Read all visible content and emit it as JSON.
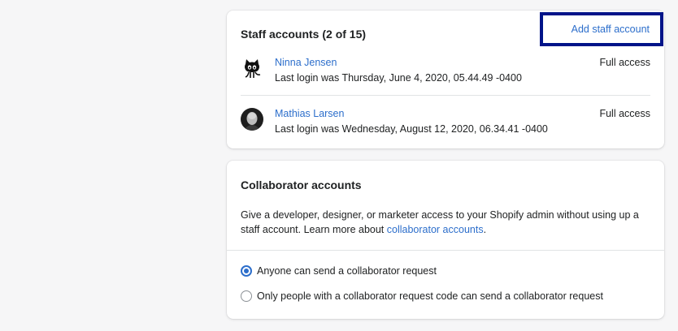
{
  "staff": {
    "title": "Staff accounts (2 of 15)",
    "add_label": "Add staff account",
    "members": [
      {
        "name": "Ninna Jensen",
        "last_login": "Last login was Thursday, June 4, 2020, 05.44.49 -0400",
        "access": "Full access",
        "avatar": "octocat-avatar-icon"
      },
      {
        "name": "Mathias Larsen",
        "last_login": "Last login was Wednesday, August 12, 2020, 06.34.41 -0400",
        "access": "Full access",
        "avatar": "person-photo-avatar"
      }
    ]
  },
  "collaborator": {
    "title": "Collaborator accounts",
    "description": "Give a developer, designer, or marketer access to your Shopify admin without using up a staff account. Learn more about ",
    "link_text": "collaborator accounts",
    "description_end": ".",
    "options": [
      {
        "label": "Anyone can send a collaborator request",
        "selected": true
      },
      {
        "label": "Only people with a collaborator request code can send a collaborator request",
        "selected": false
      }
    ]
  },
  "colors": {
    "link": "#2c6ecb",
    "highlight_border": "#001489",
    "background": "#f6f6f7"
  }
}
